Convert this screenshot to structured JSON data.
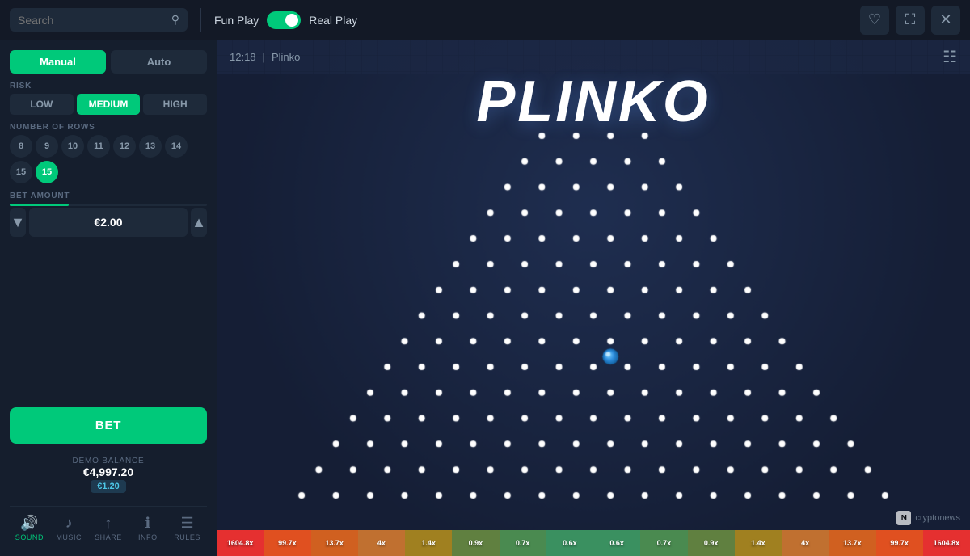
{
  "header": {
    "search_placeholder": "Search",
    "mode_fun": "Fun Play",
    "mode_real": "Real Play",
    "favorite_icon": "♡",
    "fullscreen_icon": "⛶",
    "close_icon": "✕"
  },
  "sidebar": {
    "tab_manual": "Manual",
    "tab_auto": "Auto",
    "label_risk": "RISK",
    "risk_low": "LOW",
    "risk_medium": "MEDIUM",
    "risk_high": "HIGH",
    "label_rows": "NUMBER OF ROWS",
    "rows": [
      "8",
      "9",
      "10",
      "11",
      "12",
      "13",
      "14",
      "15",
      "15"
    ],
    "label_bet": "BET AMOUNT",
    "bet_value": "€2.00",
    "bet_button": "BET",
    "demo_label": "DEMO BALANCE",
    "demo_amount": "€4,997.20",
    "demo_badge": "€1.20"
  },
  "bottom_nav": [
    {
      "label": "SOUND",
      "icon": "🔊",
      "active": true
    },
    {
      "label": "MUSIC",
      "icon": "♪"
    },
    {
      "label": "SHARE",
      "icon": "↑"
    },
    {
      "label": "INFO",
      "icon": "ℹ"
    },
    {
      "label": "RULES",
      "icon": "☰"
    }
  ],
  "game": {
    "time": "12:18",
    "title": "Plinko",
    "display_title": "PLINKO"
  },
  "multipliers": [
    {
      "value": "1604.8x",
      "color": "#e53030"
    },
    {
      "value": "99.7x",
      "color": "#e05020"
    },
    {
      "value": "13.7x",
      "color": "#d06020"
    },
    {
      "value": "4x",
      "color": "#c07030"
    },
    {
      "value": "1.4x",
      "color": "#a08020"
    },
    {
      "value": "0.9x",
      "color": "#608040"
    },
    {
      "value": "0.7x",
      "color": "#4a8a50"
    },
    {
      "value": "0.6x",
      "color": "#3a9060"
    },
    {
      "value": "0.6x",
      "color": "#3a9060"
    },
    {
      "value": "0.7x",
      "color": "#4a8a50"
    },
    {
      "value": "0.9x",
      "color": "#608040"
    },
    {
      "value": "1.4x",
      "color": "#a08020"
    },
    {
      "value": "4x",
      "color": "#c07030"
    },
    {
      "value": "13.7x",
      "color": "#d06020"
    },
    {
      "value": "99.7x",
      "color": "#e05020"
    },
    {
      "value": "1604.8x",
      "color": "#e53030"
    }
  ],
  "watermark": "cryptonews"
}
